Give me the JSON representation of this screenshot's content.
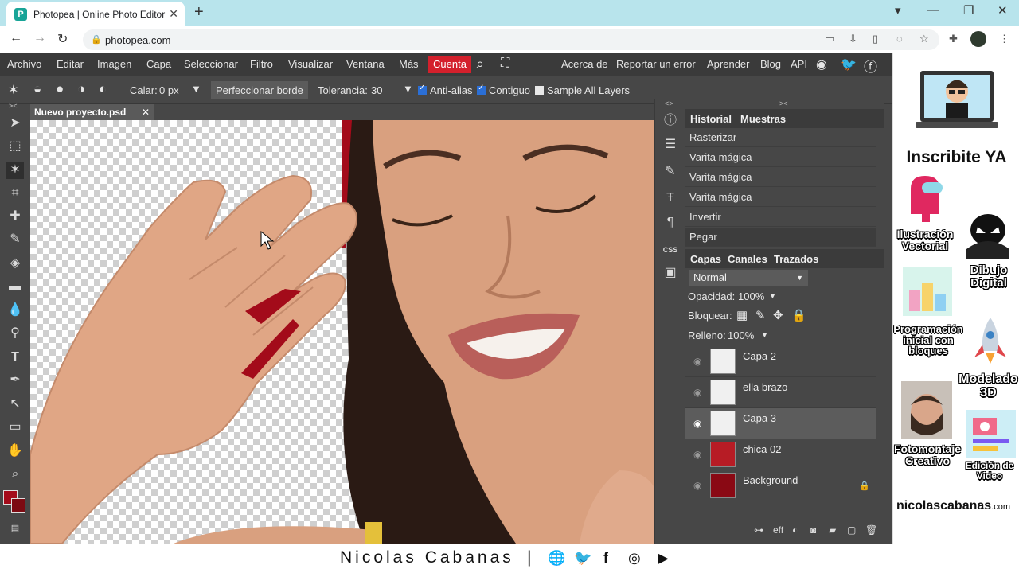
{
  "browser": {
    "tab_title": "Photopea | Online Photo Editor",
    "favicon_letter": "P",
    "url": "photopea.com"
  },
  "menu": {
    "items": [
      "Archivo",
      "Editar",
      "Imagen",
      "Capa",
      "Seleccionar",
      "Filtro",
      "Visualizar",
      "Ventana",
      "Más"
    ],
    "account": "Cuenta",
    "right_items": [
      "Acerca de",
      "Reportar un error",
      "Aprender",
      "Blog",
      "API"
    ]
  },
  "options": {
    "feather_label": "Calar:",
    "feather_value": "0 px",
    "refine_button": "Perfeccionar borde",
    "tolerance_label": "Tolerancia:",
    "tolerance_value": "30",
    "antialias": "Anti-alias",
    "contiguous": "Contiguo",
    "sample_all": "Sample All Layers"
  },
  "document": {
    "tab_name": "Nuevo proyecto.psd"
  },
  "history": {
    "tabs": [
      "Historial",
      "Muestras"
    ],
    "items": [
      "Rasterizar",
      "Varita mágica",
      "Varita mágica",
      "Varita mágica",
      "Invertir",
      "Pegar"
    ]
  },
  "layers": {
    "tabs": [
      "Capas",
      "Canales",
      "Trazados"
    ],
    "blend_mode": "Normal",
    "opacity_label": "Opacidad:",
    "opacity_value": "100%",
    "lock_label": "Bloquear:",
    "fill_label": "Relleno:",
    "fill_value": "100%",
    "items": [
      {
        "name": "Capa 2",
        "selected": false
      },
      {
        "name": "ella brazo",
        "selected": false
      },
      {
        "name": "Capa 3",
        "selected": true
      },
      {
        "name": "chica 02",
        "selected": false
      },
      {
        "name": "Background",
        "selected": false,
        "locked": true
      }
    ],
    "footer_eff": "eff"
  },
  "colors": {
    "foreground": "#a30b1a",
    "background": "#7c0a12",
    "accent": "#d4202c"
  },
  "sidebar": {
    "headline": "Inscribite YA",
    "courses": [
      "Ilustración Vectorial",
      "Dibujo Digital",
      "Programación inicial con bloques",
      "Modelado 3D",
      "Fotomontaje Creativo",
      "Edición de Video"
    ],
    "site_name": "nicolascabanas",
    "site_tld": ".com"
  },
  "footer": {
    "name": "Nicolas Cabanas",
    "separator": "|"
  }
}
